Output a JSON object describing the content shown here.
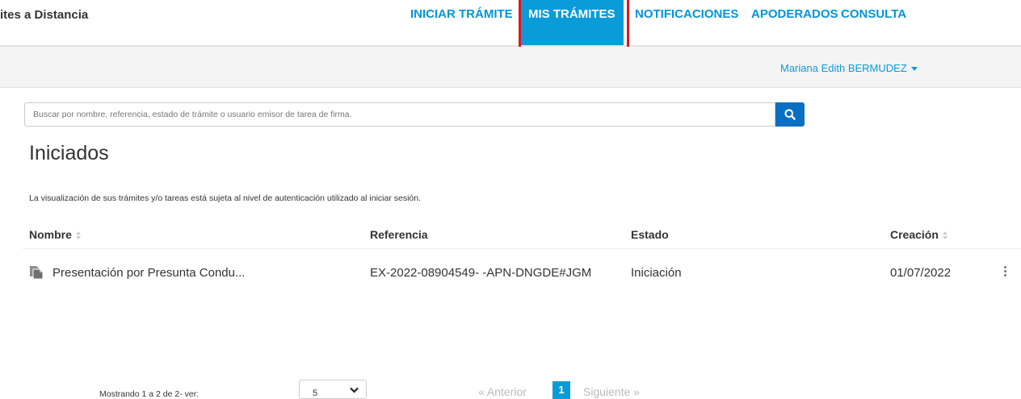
{
  "header": {
    "brand": "ites a Distancia",
    "nav": [
      {
        "label": "INICIAR TRÁMITE"
      },
      {
        "label": "MIS TRÁMITES",
        "active": true
      },
      {
        "label": "NOTIFICACIONES"
      },
      {
        "label": "APODERADOS"
      },
      {
        "label": "CONSULTA"
      }
    ]
  },
  "user": {
    "name": "Mariana Edith BERMUDEZ"
  },
  "search": {
    "placeholder": "Buscar por nombre, referencia, estado de trámite o usuario emisor de tarea de firma.",
    "value": "",
    "icon": "search-icon"
  },
  "page": {
    "title": "Iniciados",
    "notice": "La visualización de sus trámites y/o tareas está sujeta al nivel de autenticación utilizado al iniciar sesión."
  },
  "table": {
    "columns": [
      "Nombre",
      "Referencia",
      "Estado",
      "Creación"
    ],
    "rows": [
      {
        "nombre": "Presentación por Presunta Condu...",
        "referencia": "EX-2022-08904549- -APN-DNGDE#JGM",
        "estado": "Iniciación",
        "creacion": "01/07/2022"
      }
    ]
  },
  "footer": {
    "showing": "Mostrando 1 a 2 de 2- ver:",
    "page_size": "5",
    "prev": "« Anterior",
    "current_page": "1",
    "next": "Siguiente »"
  },
  "colors": {
    "accent": "#0a9bd9",
    "highlight": "#e0151b",
    "search_button": "#0a6fc2"
  }
}
